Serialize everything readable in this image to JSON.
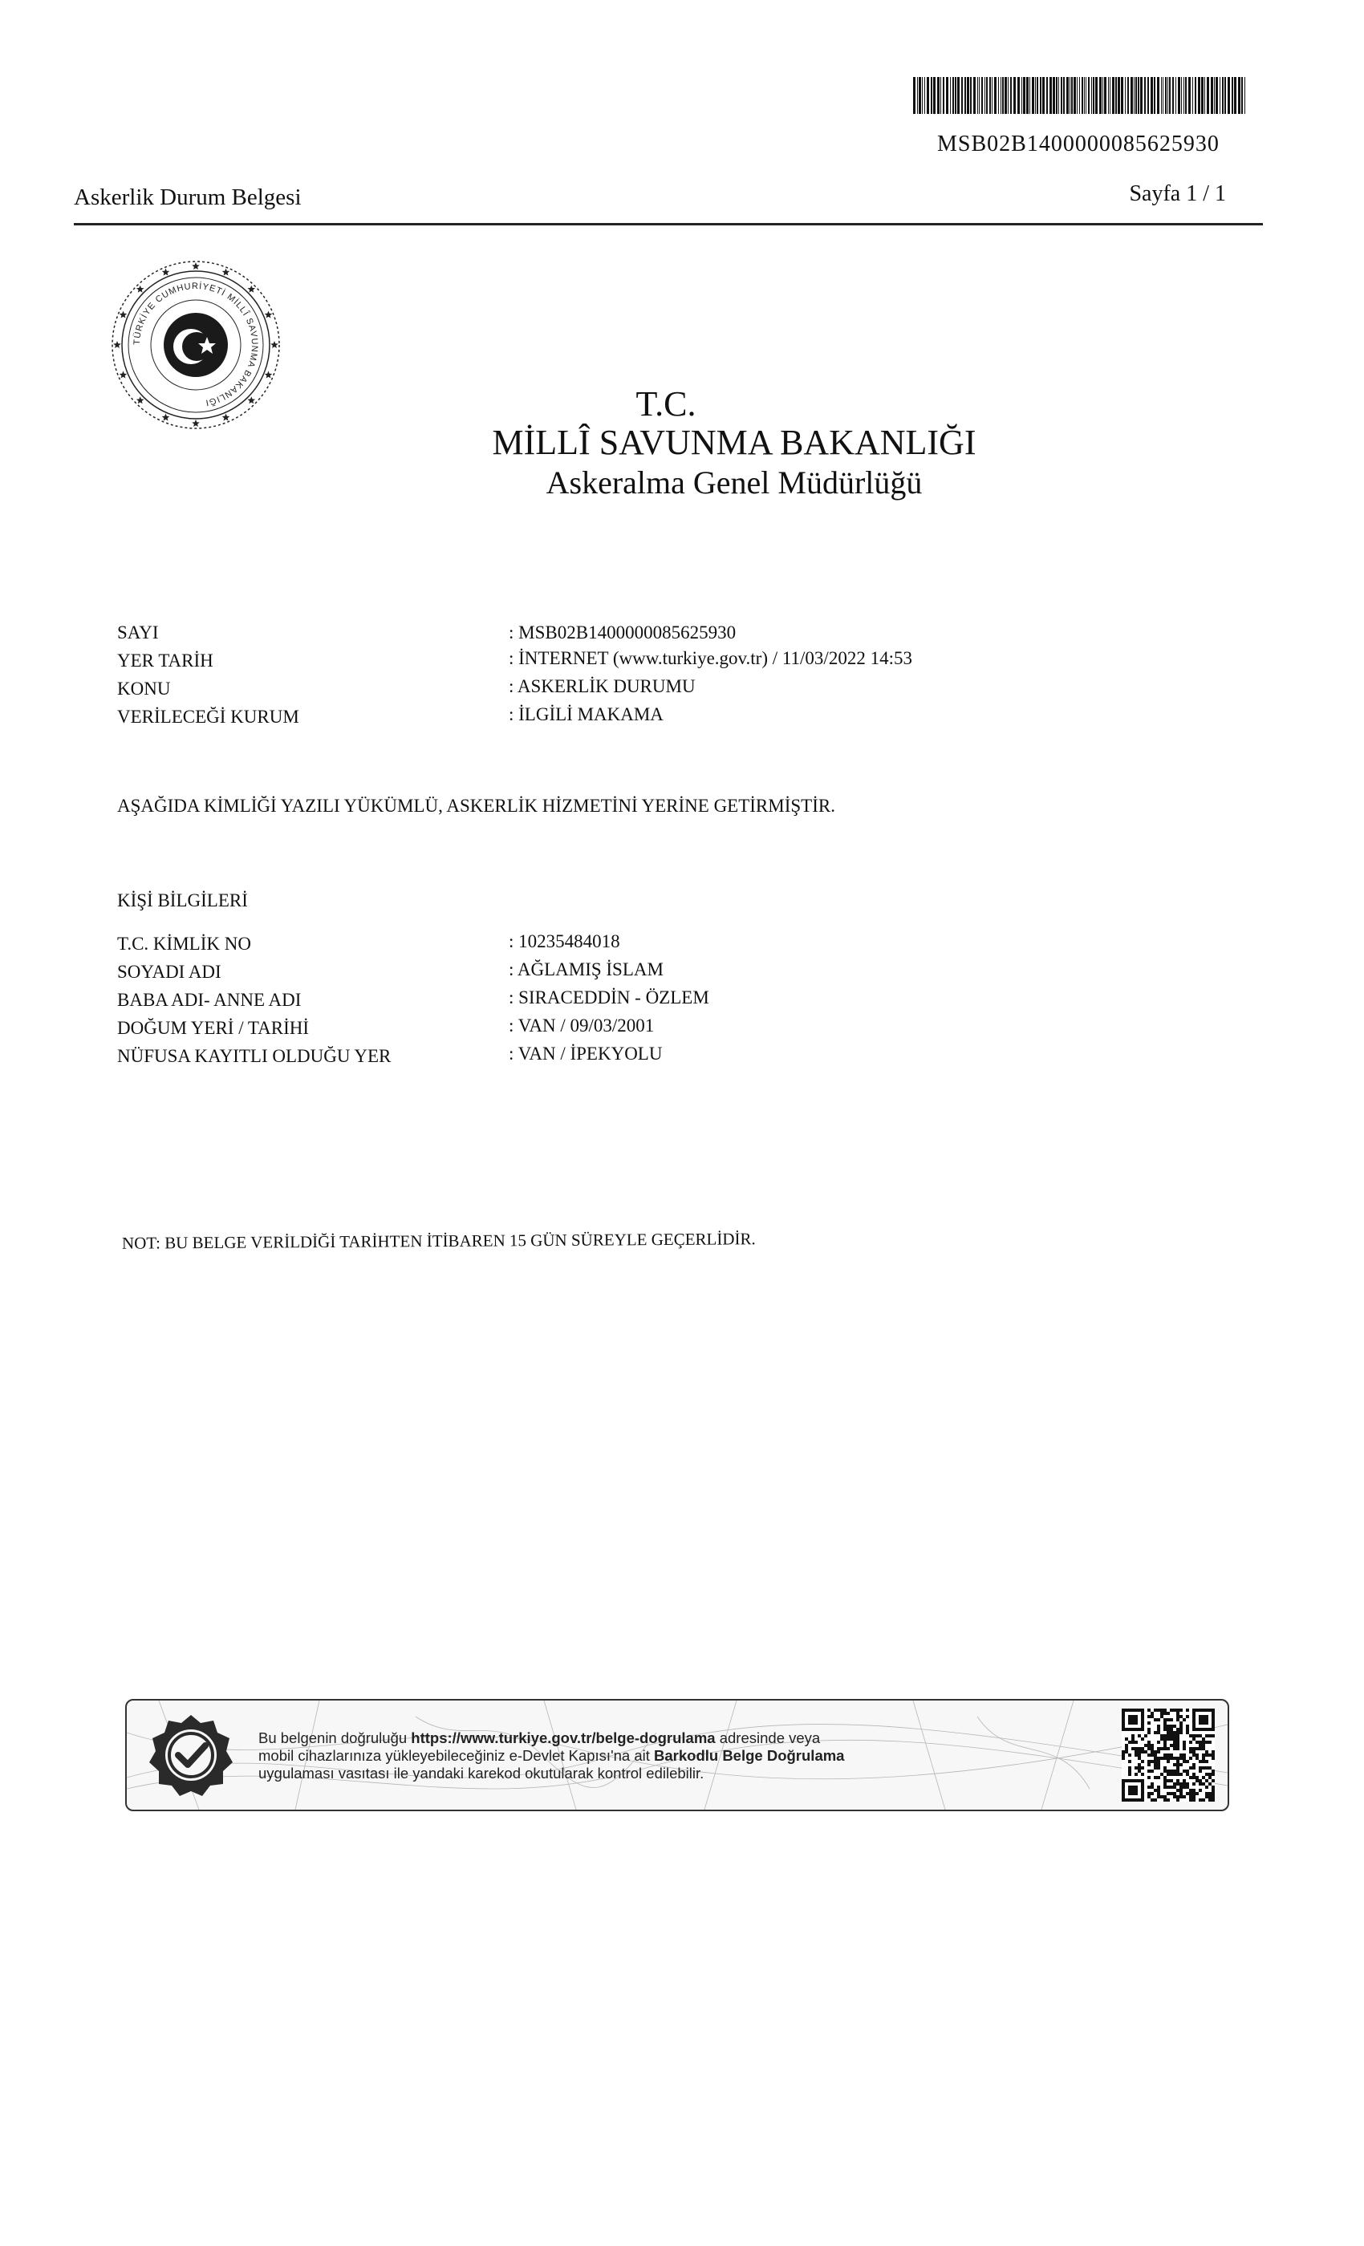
{
  "barcode": {
    "number": "MSB02B1400000085625930"
  },
  "header": {
    "doc_title": "Askerlik Durum Belgesi",
    "page": "Sayfa 1 / 1"
  },
  "seal": {
    "text": "TÜRKİYE CUMHURİYETİ MİLLÎ SAVUNMA BAKANLIĞI"
  },
  "institution": {
    "tc": "T.C.",
    "ministry": "MİLLÎ SAVUNMA BAKANLIĞI",
    "department": "Askeralma Genel Müdürlüğü"
  },
  "document_info": [
    {
      "label": "SAYI",
      "value": ": MSB02B1400000085625930"
    },
    {
      "label": "YER TARİH",
      "value": ": İNTERNET (www.turkiye.gov.tr) / 11/03/2022  14:53"
    },
    {
      "label": "KONU",
      "value": ": ASKERLİK DURUMU"
    },
    {
      "label": "VERİLECEĞİ KURUM",
      "value": ": İLGİLİ MAKAMA"
    }
  ],
  "statement": "AŞAĞIDA KİMLİĞİ YAZILI YÜKÜMLÜ, ASKERLİK HİZMETİNİ YERİNE GETİRMİŞTİR.",
  "person_section": {
    "title": "KİŞİ BİLGİLERİ",
    "rows": [
      {
        "label": "T.C. KİMLİK NO",
        "value": ": 10235484018"
      },
      {
        "label": "SOYADI ADI",
        "value": ": AĞLAMIŞ İSLAM"
      },
      {
        "label": "BABA ADI- ANNE ADI",
        "value": ": SIRACEDDİN - ÖZLEM"
      },
      {
        "label": "DOĞUM YERİ / TARİHİ",
        "value": ": VAN / 09/03/2001"
      },
      {
        "label": "NÜFUSA KAYITLI OLDUĞU YER",
        "value": ": VAN / İPEKYOLU"
      }
    ]
  },
  "note": "NOT: BU BELGE VERİLDİĞİ TARİHTEN İTİBAREN 15 GÜN SÜREYLE GEÇERLİDİR.",
  "verification": {
    "text_1": "Bu belgenin doğruluğu ",
    "url": "https://www.turkiye.gov.tr/belge-dogrulama",
    "text_2": " adresinde veya",
    "text_3": "mobil cihazlarınıza yükleyebileceğiniz e-Devlet Kapısı'na ait ",
    "app_name": "Barkodlu Belge Doğrulama",
    "text_4": "uygulaması vasıtası ile yandaki karekod okutularak kontrol edilebilir."
  }
}
